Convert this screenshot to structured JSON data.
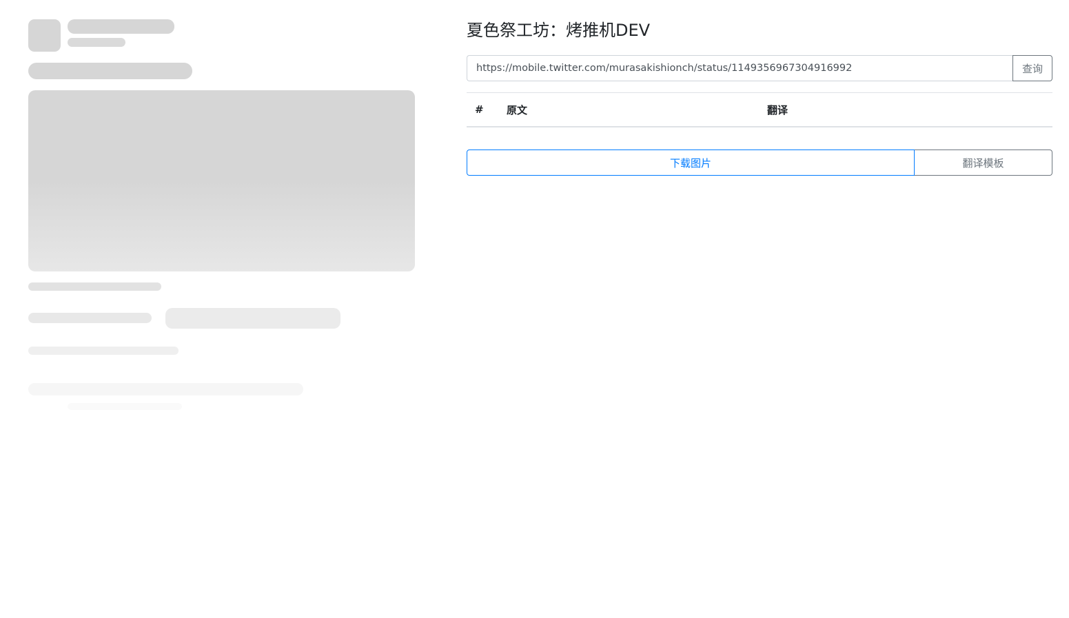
{
  "title": "夏色祭工坊：烤推机DEV",
  "query": {
    "input_value": "https://mobile.twitter.com/murasakishionch/status/1149356967304916992",
    "button_label": "查询"
  },
  "table": {
    "headers": [
      "#",
      "原文",
      "翻译"
    ],
    "rows": []
  },
  "actions": {
    "download_label": "下载图片",
    "template_label": "翻译模板"
  },
  "colors": {
    "primary": "#007bff",
    "secondary": "#6c757d",
    "skeleton": "#d6d6d6"
  }
}
